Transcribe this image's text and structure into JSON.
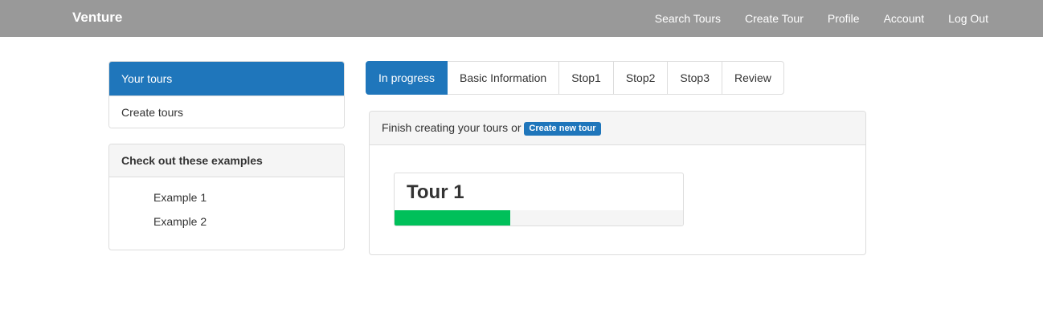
{
  "navbar": {
    "brand": "Venture",
    "links": [
      "Search Tours",
      "Create Tour",
      "Profile",
      "Account",
      "Log Out"
    ]
  },
  "sidebar": {
    "active_item": "Your tours",
    "item": "Create tours",
    "examples_heading": "Check out these examples",
    "examples": [
      "Example 1",
      "Example 2"
    ]
  },
  "tabs": [
    "In progress",
    "Basic Information",
    "Stop1",
    "Stop2",
    "Stop3",
    "Review"
  ],
  "main": {
    "heading_text": "Finish creating your tours or",
    "create_button": "Create new tour",
    "tour": {
      "title": "Tour 1",
      "progress_percent": 40
    }
  },
  "colors": {
    "navbar": "#999999",
    "primary": "#1f76bb",
    "progress": "#00c05a"
  }
}
